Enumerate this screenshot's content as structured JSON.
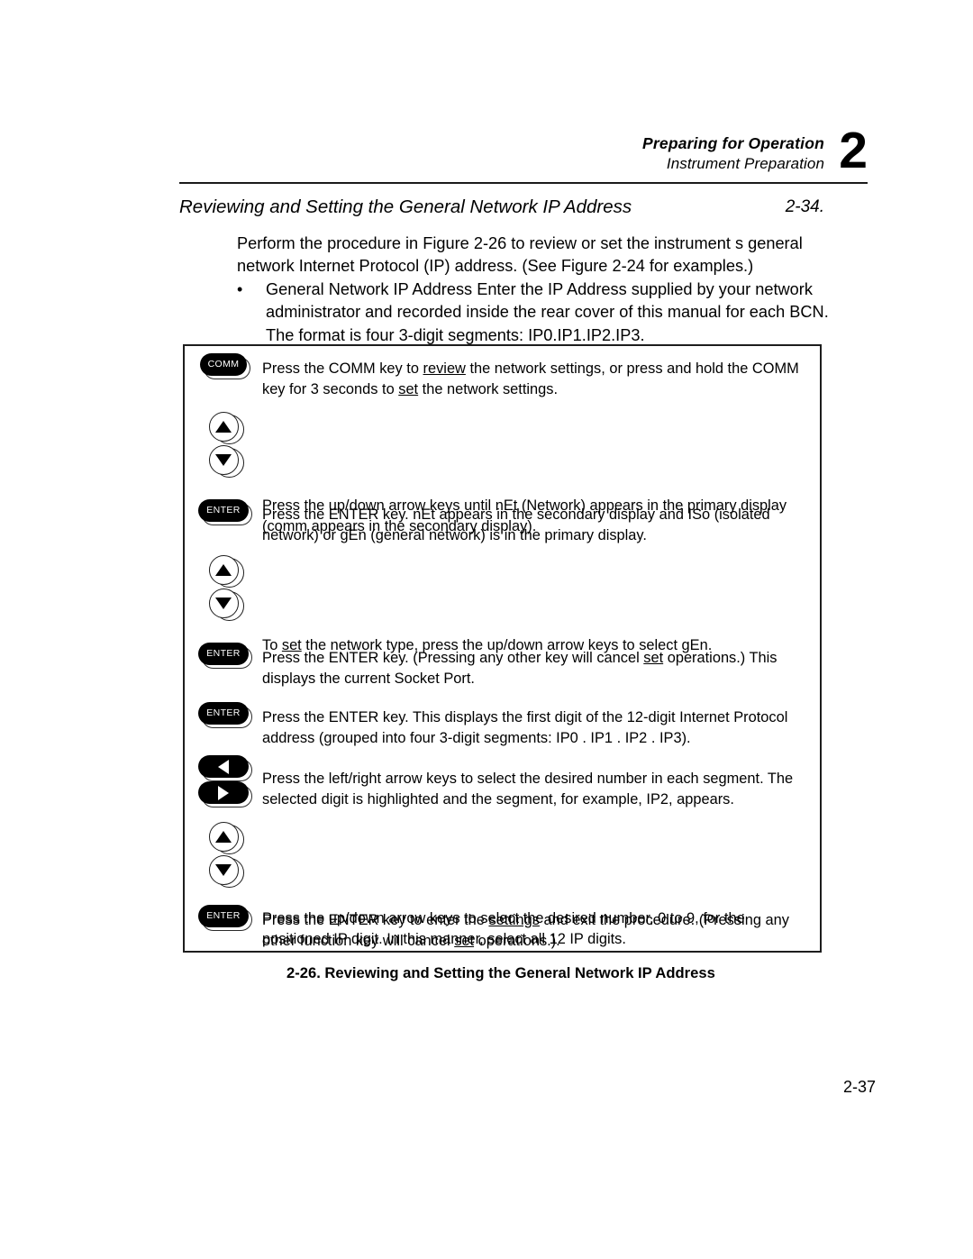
{
  "header": {
    "line1": "Preparing for Operation",
    "line2": "Instrument Preparation",
    "chapter": "2"
  },
  "section": {
    "title": "Reviewing and Setting the General Network IP Address",
    "number": "2-34."
  },
  "intro": {
    "paragraph": "Perform the procedure in Figure 2-26 to review or set the instrument s general network Internet Protocol (IP) address. (See Figure 2-24 for examples.)"
  },
  "bullet": {
    "mark": "•",
    "text": "General Network IP Address Enter the IP Address supplied by your network administrator and recorded inside the rear cover of this manual for each BCN. The format is four 3-digit segments: IP0.IP1.IP2.IP3."
  },
  "figure": {
    "caption": "2-26. Reviewing and Setting the General Network IP Address",
    "steps": [
      {
        "keys": [
          "COMM"
        ],
        "key_type": "pill",
        "text_html": "Press the COMM key to <u>review</u> the network settings, or press and hold the COMM key for 3 seconds to <u>set</u> the network settings."
      },
      {
        "keys": [
          "up",
          "down"
        ],
        "key_type": "round",
        "text_html": "Press the up/down arrow keys until nEt (Network) appears in the primary display (comm appears in the secondary display)."
      },
      {
        "keys": [
          "ENTER"
        ],
        "key_type": "pill",
        "text_html": "Press the ENTER key. nEt appears in the secondary display and ISo (isolated network) or gEn (general network) is in the primary display."
      },
      {
        "keys": [
          "up",
          "down"
        ],
        "key_type": "round",
        "text_html": "To <u>set</u> the network type, press the up/down arrow keys to select gEn."
      },
      {
        "keys": [
          "ENTER"
        ],
        "key_type": "pill",
        "text_html": "Press the ENTER key. (Pressing any other key will cancel <u>set</u> operations.) This displays the current Socket Port."
      },
      {
        "keys": [
          "ENTER"
        ],
        "key_type": "pill",
        "text_html": "Press the ENTER key. This displays the first digit of the 12-digit Internet Protocol address (grouped into four 3-digit segments: IP0 . IP1 . IP2 . IP3)."
      },
      {
        "keys": [
          "left",
          "right"
        ],
        "key_type": "pill-arrow",
        "text_html": "Press the left/right arrow keys to select the desired number in each segment. The selected digit is highlighted and the segment, for example, IP2, appears."
      },
      {
        "keys": [
          "up",
          "down"
        ],
        "key_type": "round",
        "text_html": "Press the up/down arrow keys to select the desired number, 0 to 9, for the positioned IP digit. In this manner, select all 12 IP digits."
      },
      {
        "keys": [
          "ENTER"
        ],
        "key_type": "pill",
        "text_html": "Press the ENTER key to enter the <u>settings</u> and exit the procedure. (Pressing any other function key will cancel <u>set</u> operations.)."
      }
    ],
    "key_labels": {
      "comm": "COMM",
      "enter": "ENTER"
    }
  },
  "folio": {
    "page_number": "2-37"
  },
  "colors": {
    "ink": "#000000",
    "rule": "#1d1d1d",
    "paper": "#ffffff"
  }
}
